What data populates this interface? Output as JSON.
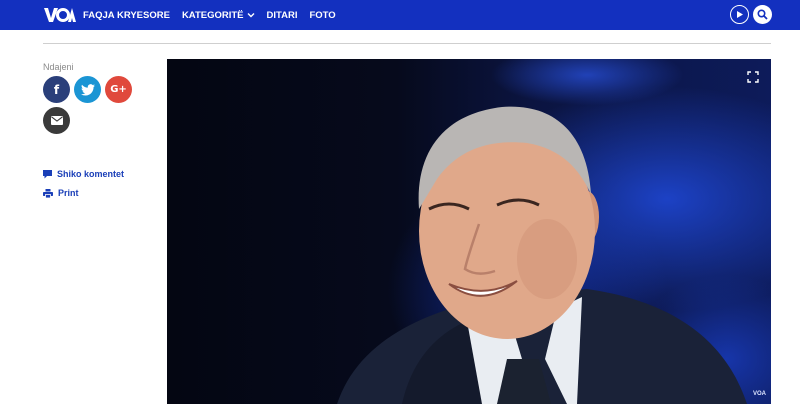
{
  "header": {
    "logo": "VOA",
    "nav": [
      {
        "label": "FAQJA KRYESORE"
      },
      {
        "label": "KATEGORITË"
      },
      {
        "label": "DITARI"
      },
      {
        "label": "FOTO"
      }
    ]
  },
  "sidebar": {
    "share_label": "Ndajeni",
    "share_buttons": [
      {
        "network": "facebook",
        "glyph": "f",
        "icon": "facebook-icon",
        "color": "#2a3f7a"
      },
      {
        "network": "twitter",
        "glyph": "",
        "icon": "twitter-bird-icon",
        "color": "#1b95d4"
      },
      {
        "network": "google-plus",
        "glyph": "G+",
        "icon": "google-plus-icon",
        "color": "#e0493c"
      },
      {
        "network": "email",
        "glyph": "",
        "icon": "envelope-icon",
        "color": "#3a3a3a"
      }
    ],
    "comments_label": "Shiko komentet",
    "print_label": "Print"
  },
  "media": {
    "credit": "VOA",
    "icon": "fullscreen-icon"
  },
  "colors": {
    "brand": "#1330bf",
    "link": "#1a3fb8"
  }
}
